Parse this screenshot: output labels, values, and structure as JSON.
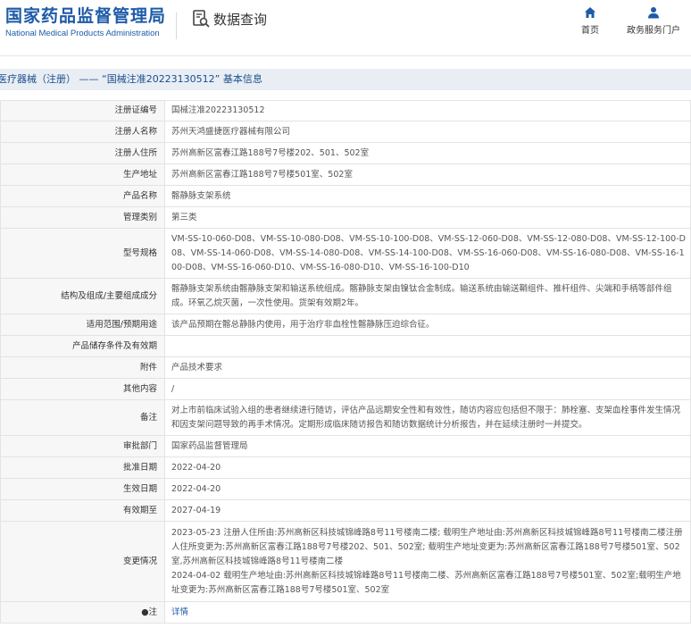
{
  "header": {
    "logo_cn": "国家药品监督管理局",
    "logo_en": "National Medical Products Administration",
    "query_label": "数据查询",
    "nav": [
      {
        "label": "首页",
        "icon": "home-icon"
      },
      {
        "label": "政务服务门户",
        "icon": "person-icon"
      }
    ]
  },
  "breadcrumb": "医疗器械（注册） —— “国械注准20223130512” 基本信息",
  "fields": [
    {
      "key": "注册证编号",
      "value": "国械注准20223130512"
    },
    {
      "key": "注册人名称",
      "value": "苏州天鸿盛捷医疗器械有限公司"
    },
    {
      "key": "注册人住所",
      "value": "苏州高新区富春江路188号7号楼202、501、502室"
    },
    {
      "key": "生产地址",
      "value": "苏州高新区富春江路188号7号楼501室、502室"
    },
    {
      "key": "产品名称",
      "value": "髂静脉支架系统"
    },
    {
      "key": "管理类别",
      "value": "第三类"
    },
    {
      "key": "型号规格",
      "value": "VM-SS-10-060-D08、VM-SS-10-080-D08、VM-SS-10-100-D08、VM-SS-12-060-D08、VM-SS-12-080-D08、VM-SS-12-100-D08、VM-SS-14-060-D08、VM-SS-14-080-D08、VM-SS-14-100-D08、VM-SS-16-060-D08、VM-SS-16-080-D08、VM-SS-16-100-D08、VM-SS-16-060-D10、VM-SS-16-080-D10、VM-SS-16-100-D10"
    },
    {
      "key": "结构及组成/主要组成成分",
      "value": "髂静脉支架系统由髂静脉支架和输送系统组成。髂静脉支架由镍钛合金制成。输送系统由输送鞘组件、推杆组件、尖端和手柄等部件组成。环氧乙烷灭菌，一次性使用。货架有效期2年。"
    },
    {
      "key": "适用范围/预期用途",
      "value": "该产品预期在髂总静脉内使用，用于治疗非血栓性髂静脉压迫综合征。"
    },
    {
      "key": "产品储存条件及有效期",
      "value": ""
    },
    {
      "key": "附件",
      "value": "产品技术要求"
    },
    {
      "key": "其他内容",
      "value": "/"
    },
    {
      "key": "备注",
      "value": "对上市前临床试验入组的患者继续进行随访，评估产品远期安全性和有效性，随访内容应包括但不限于：肺栓塞、支架血栓事件发生情况和因支架问题导致的再手术情况。定期形成临床随访报告和随访数据统计分析报告，并在延续注册时一并提交。"
    },
    {
      "key": "审批部门",
      "value": "国家药品监督管理局"
    },
    {
      "key": "批准日期",
      "value": "2022-04-20"
    },
    {
      "key": "生效日期",
      "value": "2022-04-20"
    },
    {
      "key": "有效期至",
      "value": "2027-04-19"
    }
  ],
  "change_history": {
    "key": "变更情况",
    "entries": [
      "2023-05-23 注册人住所由:苏州高新区科技城锦峰路8号11号楼南二楼; 载明生产地址由:苏州高新区科技城锦峰路8号11号楼南二楼注册人住所变更为:苏州高新区富春江路188号7号楼202、501、502室; 载明生产地址变更为:苏州高新区富春江路188号7号楼501室、502室,苏州高新区科技城锦峰路8号11号楼南二楼",
      "2024-04-02 载明生产地址由:苏州高新区科技城锦峰路8号11号楼南二楼、苏州高新区富春江路188号7号楼501室、502室;载明生产地址变更为:苏州高新区富春江路188号7号楼501室、502室"
    ]
  },
  "note": {
    "key": "注",
    "link": "详情",
    "icon": "info-dot-icon"
  }
}
